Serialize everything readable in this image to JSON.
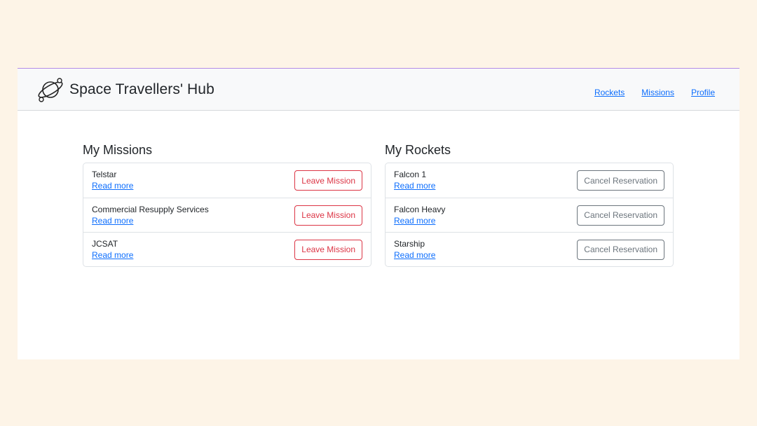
{
  "header": {
    "title": "Space Travellers' Hub",
    "logo_icon": "planet-icon",
    "nav": [
      {
        "label": "Rockets"
      },
      {
        "label": "Missions"
      },
      {
        "label": "Profile"
      }
    ]
  },
  "missions": {
    "title": "My Missions",
    "items": [
      {
        "name": "Telstar",
        "link": "Read more",
        "action": "Leave Mission"
      },
      {
        "name": "Commercial Resupply Services",
        "link": "Read more",
        "action": "Leave Mission"
      },
      {
        "name": "JCSAT",
        "link": "Read more",
        "action": "Leave Mission"
      }
    ]
  },
  "rockets": {
    "title": "My Rockets",
    "items": [
      {
        "name": "Falcon 1",
        "link": "Read more",
        "action": "Cancel Reservation"
      },
      {
        "name": "Falcon Heavy",
        "link": "Read more",
        "action": "Cancel Reservation"
      },
      {
        "name": "Starship",
        "link": "Read more",
        "action": "Cancel Reservation"
      }
    ]
  },
  "colors": {
    "page_background": "#fdf4e7",
    "link": "#0d6efd",
    "danger": "#dc3545",
    "secondary": "#6c757d"
  }
}
